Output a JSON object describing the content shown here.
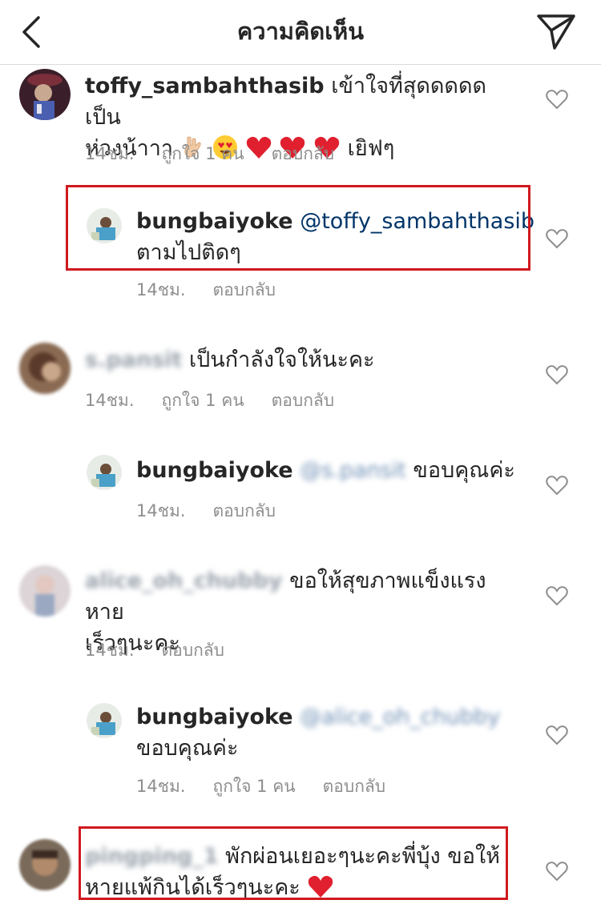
{
  "header": {
    "title": "ความคิดเห็น",
    "back_icon": "chevron-left-icon",
    "share_icon": "direct-send-icon"
  },
  "comments": [
    {
      "username": "toffy_sambahthasib",
      "text_line1": "เข้าใจที่สุดดดดด เป็น",
      "text_line2": "ห่วงน้าาา",
      "text_tail": "เยิฟๆ",
      "emojis": [
        "rock-hand",
        "heart-eyes",
        "red-heart",
        "red-heart",
        "red-heart"
      ],
      "time": "14ชม.",
      "likes": "ถูกใจ 1 คน",
      "reply": "ตอบกลับ"
    },
    {
      "username": "bungbaiyoke",
      "mention": "@toffy_sambahthasib",
      "text": "ตามไปติดๆ",
      "time": "14ชม.",
      "reply": "ตอบกลับ"
    },
    {
      "username_blurred": "s.pansit",
      "text": "เป็นกำลังใจให้นะคะ",
      "time": "14ชม.",
      "likes": "ถูกใจ 1 คน",
      "reply": "ตอบกลับ"
    },
    {
      "username": "bungbaiyoke",
      "mention_blurred": "@s.pansit",
      "text": "ขอบคุณค่ะ",
      "time": "14ชม.",
      "reply": "ตอบกลับ"
    },
    {
      "username_blurred": "alice_oh_chubby",
      "text_line1": "ขอให้สุขภาพแข็งแรงหาย",
      "text_line2": "เร็วๆนะคะ",
      "time": "14ชม.",
      "reply": "ตอบกลับ"
    },
    {
      "username": "bungbaiyoke",
      "mention_blurred": "@alice_oh_chubby",
      "text": "ขอบคุณค่ะ",
      "time": "14ชม.",
      "likes": "ถูกใจ 1 คน",
      "reply": "ตอบกลับ"
    },
    {
      "username_blurred": "pingping_1",
      "text_line1": "พักผ่อนเยอะๆนะคะพี่บุ้ง ขอให้",
      "text_line2": "หายแพ้กินได้เร็วๆนะคะ",
      "emojis": [
        "red-heart"
      ]
    }
  ],
  "colors": {
    "text": "#262626",
    "meta": "#8e8e8e",
    "mention": "#003569",
    "highlight": "#d0191e",
    "divider": "#dbdbdb"
  }
}
